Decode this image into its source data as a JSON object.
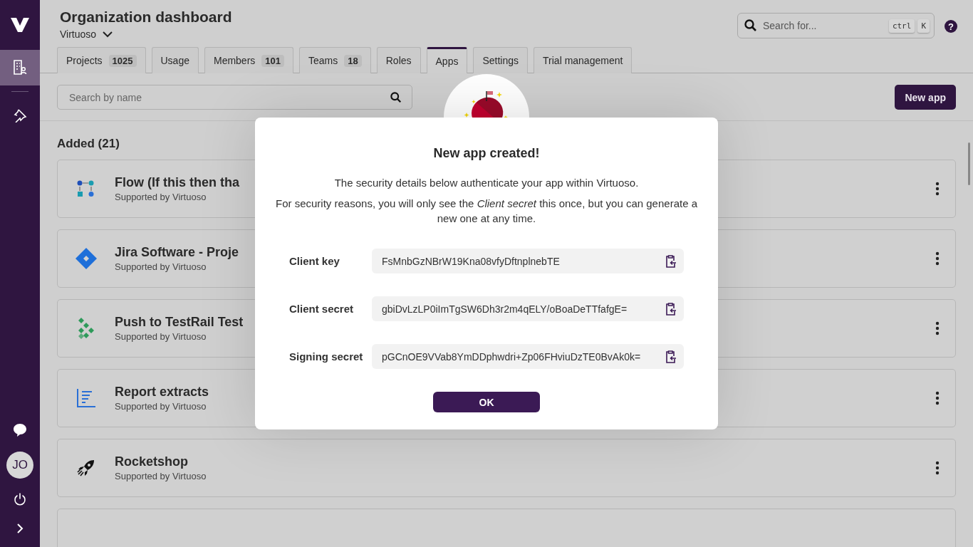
{
  "header": {
    "title": "Organization dashboard",
    "organization": "Virtuoso",
    "search": {
      "placeholder": "Search for...",
      "shortcut_keys": [
        "ctrl",
        "K"
      ]
    },
    "help": "?"
  },
  "sidebar": {
    "items": [
      {
        "kind": "organization",
        "selected": true
      },
      {
        "kind": "pin",
        "selected": false
      }
    ],
    "avatar": "JO"
  },
  "tabs": [
    {
      "label": "Projects",
      "count": "1025",
      "selected": false
    },
    {
      "label": "Usage",
      "selected": false
    },
    {
      "label": "Members",
      "count": "101",
      "selected": false
    },
    {
      "label": "Teams",
      "count": "18",
      "selected": false
    },
    {
      "label": "Roles",
      "selected": false
    },
    {
      "label": "Apps",
      "selected": true
    },
    {
      "label": "Settings",
      "selected": false
    },
    {
      "label": "Trial management",
      "selected": false
    }
  ],
  "toolbar": {
    "search_placeholder": "Search by name",
    "new_button": "New app"
  },
  "section_title": "Added (21)",
  "apps": [
    {
      "name": "Flow (If this then tha",
      "subtitle": "Supported by Virtuoso",
      "kind": "flow"
    },
    {
      "name": "Jira Software - Proje",
      "subtitle": "Supported by Virtuoso",
      "kind": "jira"
    },
    {
      "name": "Push to TestRail Test",
      "subtitle": "Supported by Virtuoso",
      "kind": "testrail"
    },
    {
      "name": "Report extracts",
      "subtitle": "Supported by Virtuoso",
      "kind": "report"
    },
    {
      "name": "Rocketshop",
      "subtitle": "Supported by Virtuoso",
      "kind": "rocket"
    }
  ],
  "dialog": {
    "title": "New app created!",
    "paragraphs": [
      "The security details below authenticate your app within Virtuoso.",
      "For security reasons, you will only see the *Client secret* this once, but you can generate a new one at any time."
    ],
    "fields": [
      {
        "label": "Client key",
        "value": "FsMnbGzNBrW19Kna08vfyDftnplnebTE"
      },
      {
        "label": "Client secret",
        "value": "gbiDvLzLP0iImTgSW6Dh3r2m4qELY/oBoaDeTTfafgE="
      },
      {
        "label": "Signing secret",
        "value": "pGCnOE9VVab8YmDDphwdri+Zp06FHviuDzTE0BvAk0k="
      }
    ],
    "ok_button": "OK"
  }
}
